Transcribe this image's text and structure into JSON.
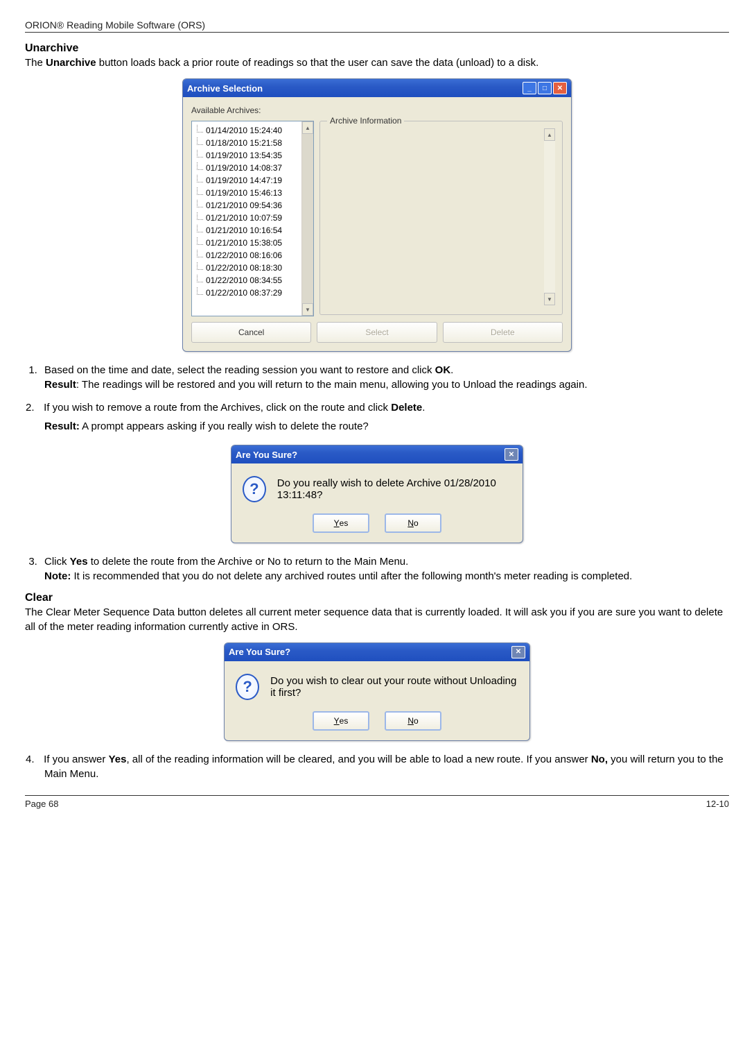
{
  "header": {
    "left": "ORION® Reading Mobile Software (ORS)",
    "right": ""
  },
  "unarchive": {
    "heading": "Unarchive",
    "intro_pre": "The ",
    "intro_bold": "Unarchive",
    "intro_post": " button loads back a prior route of readings so that the user can save the data (unload) to a disk.",
    "window": {
      "title": "Archive Selection",
      "available_label": "Available Archives:",
      "group_title": "Archive Information",
      "items": [
        "01/14/2010 15:24:40",
        "01/18/2010 15:21:58",
        "01/19/2010 13:54:35",
        "01/19/2010 14:08:37",
        "01/19/2010 14:47:19",
        "01/19/2010 15:46:13",
        "01/21/2010 09:54:36",
        "01/21/2010 10:07:59",
        "01/21/2010 10:16:54",
        "01/21/2010 15:38:05",
        "01/22/2010 08:16:06",
        "01/22/2010 08:18:30",
        "01/22/2010 08:34:55",
        "01/22/2010 08:37:29"
      ],
      "btn_cancel": "Cancel",
      "btn_select": "Select",
      "btn_delete": "Delete"
    },
    "step1": {
      "text_pre": "Based on the time and date, select the reading session you want to restore and click ",
      "text_bold": "OK",
      "text_post": ".",
      "result_label": "Result",
      "result_text": ": The readings will be restored and you will return to the main menu, allowing you to Unload the readings again."
    },
    "step2": {
      "num": "2.",
      "text_pre": " If you wish to remove a route from the Archives, click on the route and click ",
      "text_bold": "Delete",
      "text_post": ".",
      "result_label": "Result:",
      "result_text": " A prompt appears asking if you really wish to delete the route?"
    },
    "dialog1": {
      "title": "Are You Sure?",
      "message": "Do you really wish to delete Archive 01/28/2010 13:11:48?",
      "yes_u": "Y",
      "yes_rest": "es",
      "no_u": "N",
      "no_rest": "o"
    },
    "step3": {
      "text_pre": "Click ",
      "text_bold": "Yes",
      "text_post": " to delete the route from the Archive or No to return to the Main Menu.",
      "note_label": "Note:",
      "note_text": " It is recommended that you do not delete any archived routes until after the following month's meter reading is completed."
    }
  },
  "clear": {
    "heading": "Clear",
    "intro": "The Clear Meter Sequence Data button deletes all current meter sequence data that is currently loaded. It will ask you if you are sure you want to delete all of the meter reading information currently active in ORS.",
    "dialog": {
      "title": "Are You Sure?",
      "message": "Do you wish to clear out your route without Unloading it first?",
      "yes_u": "Y",
      "yes_rest": "es",
      "no_u": "N",
      "no_rest": "o"
    },
    "step4": {
      "num": "4.",
      "text_pre": " If you answer ",
      "bold1": "Yes",
      "mid": ", all of the reading information will be cleared, and you will be able to load a new route. If you answer ",
      "bold2": "No,",
      "post": " you will return you to the Main Menu."
    }
  },
  "footer": {
    "left": "Page 68",
    "right": "12-10"
  }
}
